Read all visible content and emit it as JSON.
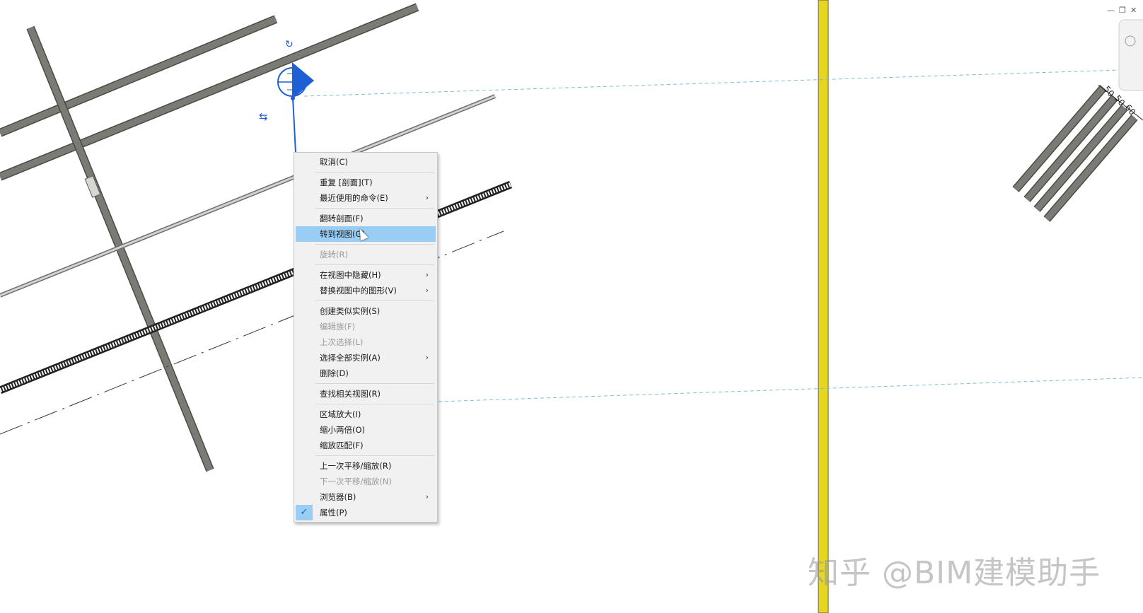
{
  "window_controls": {
    "minimize": "—",
    "restore": "❐",
    "close": "✕"
  },
  "context_menu": {
    "groups": [
      [
        {
          "label": "取消(C)",
          "disabled": false
        }
      ],
      [
        {
          "label": "重复 [剖面](T)",
          "disabled": false
        },
        {
          "label": "最近使用的命令(E)",
          "submenu": true
        }
      ],
      [
        {
          "label": "翻转剖面(F)"
        },
        {
          "label": "转到视图(G)",
          "highlighted": true
        }
      ],
      [
        {
          "label": "旋转(R)",
          "disabled": true
        }
      ],
      [
        {
          "label": "在视图中隐藏(H)",
          "submenu": true
        },
        {
          "label": "替换视图中的图形(V)",
          "submenu": true
        }
      ],
      [
        {
          "label": "创建类似实例(S)"
        },
        {
          "label": "编辑族(F)",
          "disabled": true
        },
        {
          "label": "上次选择(L)",
          "disabled": true
        },
        {
          "label": "选择全部实例(A)",
          "submenu": true
        },
        {
          "label": "删除(D)"
        }
      ],
      [
        {
          "label": "查找相关视图(R)"
        }
      ],
      [
        {
          "label": "区域放大(I)"
        },
        {
          "label": "缩小两倍(O)"
        },
        {
          "label": "缩放匹配(F)"
        }
      ],
      [
        {
          "label": "上一次平移/缩放(R)"
        },
        {
          "label": "下一次平移/缩放(N)",
          "disabled": true
        },
        {
          "label": "浏览器(B)",
          "submenu": true
        },
        {
          "label": "属性(P)",
          "checked": true
        }
      ]
    ]
  },
  "dimension_labels": [
    "50",
    "50",
    "60"
  ],
  "watermark": "知乎 @BIM建模助手",
  "colors": {
    "wall": "#777772",
    "selection": "#1f5fd6",
    "gridline": "#e6d620",
    "highlight": "#99cdf3",
    "dashed_ref": "#7bbbe0"
  }
}
